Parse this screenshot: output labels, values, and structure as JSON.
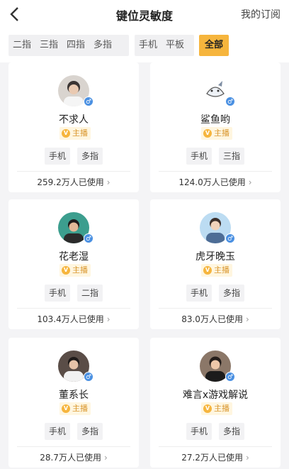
{
  "header": {
    "title": "键位灵敏度",
    "subscription": "我的订阅"
  },
  "filters": {
    "group1": [
      "二指",
      "三指",
      "四指",
      "多指"
    ],
    "group2": [
      "手机",
      "平板"
    ],
    "selected": "全部"
  },
  "badge_label": "主播",
  "gender_symbol": "♂",
  "usage_suffix": "万人已使用",
  "cards": [
    {
      "name": "不求人",
      "tags": [
        "手机",
        "多指"
      ],
      "usage": "259.2万人已使用"
    },
    {
      "name": "鲨鱼哟",
      "tags": [
        "手机",
        "三指"
      ],
      "usage": "124.0万人已使用"
    },
    {
      "name": "花老湿",
      "tags": [
        "手机",
        "二指"
      ],
      "usage": "103.4万人已使用"
    },
    {
      "name": "虎牙晚玉",
      "tags": [
        "手机",
        "多指"
      ],
      "usage": "83.0万人已使用"
    },
    {
      "name": "董系长",
      "tags": [
        "手机",
        "多指"
      ],
      "usage": "28.7万人已使用"
    },
    {
      "name": "难言x游戏解说",
      "tags": [
        "手机",
        "多指"
      ],
      "usage": "27.2万人已使用"
    }
  ],
  "colors": {
    "accent": "#f6b53d",
    "badge_text": "#d9962d",
    "gender": "#4a90e2",
    "background": "#f4f4f6"
  }
}
